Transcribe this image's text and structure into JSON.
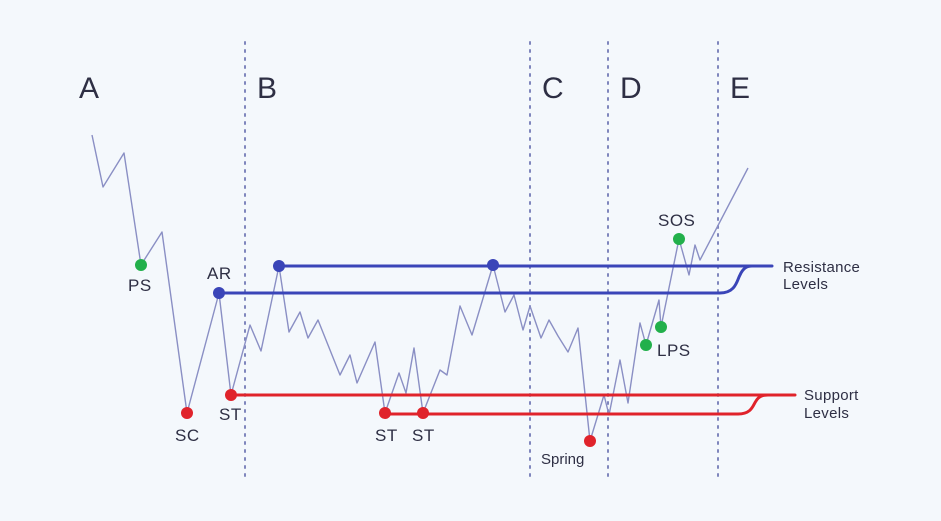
{
  "phases": [
    "A",
    "B",
    "C",
    "D",
    "E"
  ],
  "events": {
    "ps": "PS",
    "sc": "SC",
    "ar": "AR",
    "st1": "ST",
    "st2": "ST",
    "st3": "ST",
    "spring": "Spring",
    "lps": "LPS",
    "sos": "SOS"
  },
  "legend": {
    "resistance_1": "Resistance",
    "resistance_2": "Levels",
    "support_1": "Support",
    "support_2": "Levels"
  },
  "colors": {
    "background": "#f4f8fc",
    "price_line": "#8a8fc4",
    "resistance": "#3a45b8",
    "support": "#e0232b",
    "bullish_point": "#22b04b",
    "divider": "#7f86bd",
    "text": "#2e2f44"
  }
}
